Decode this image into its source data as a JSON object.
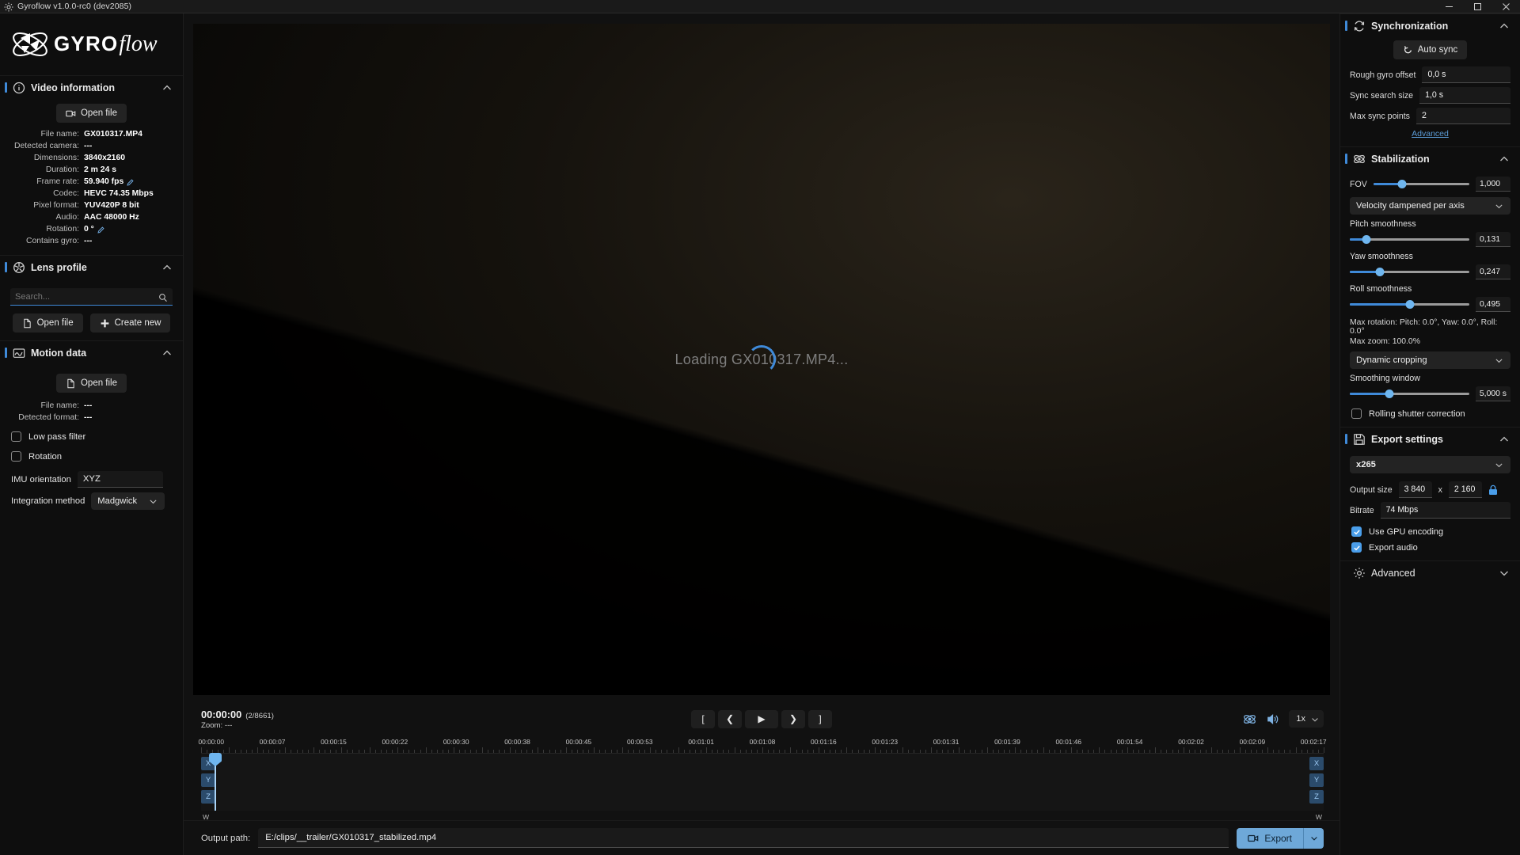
{
  "window": {
    "title": "Gyroflow v1.0.0-rc0 (dev2085)",
    "minimize": "─",
    "maximize": "☐",
    "close": "✕"
  },
  "brand": {
    "gyro": "GYRO",
    "flow": "flow"
  },
  "sidebar": {
    "video_information": {
      "title": "Video information",
      "open_file": "Open file",
      "fields": [
        {
          "label": "File name:",
          "value": "GX010317.MP4",
          "edit": false
        },
        {
          "label": "Detected camera:",
          "value": "---",
          "edit": false
        },
        {
          "label": "Dimensions:",
          "value": "3840x2160",
          "edit": false
        },
        {
          "label": "Duration:",
          "value": "2 m 24 s",
          "edit": false
        },
        {
          "label": "Frame rate:",
          "value": "59.940 fps",
          "edit": true
        },
        {
          "label": "Codec:",
          "value": "HEVC 74.35 Mbps",
          "edit": false
        },
        {
          "label": "Pixel format:",
          "value": "YUV420P 8 bit",
          "edit": false
        },
        {
          "label": "Audio:",
          "value": "AAC 48000 Hz",
          "edit": false
        },
        {
          "label": "Rotation:",
          "value": "0 °",
          "edit": true
        },
        {
          "label": "Contains gyro:",
          "value": "---",
          "edit": false
        }
      ]
    },
    "lens_profile": {
      "title": "Lens profile",
      "search_placeholder": "Search...",
      "search_value": "",
      "open_file": "Open file",
      "create_new": "Create new"
    },
    "motion_data": {
      "title": "Motion data",
      "open_file": "Open file",
      "fields": [
        {
          "label": "File name:",
          "value": "---"
        },
        {
          "label": "Detected format:",
          "value": "---"
        }
      ],
      "low_pass_filter": {
        "label": "Low pass filter",
        "checked": false
      },
      "rotation": {
        "label": "Rotation",
        "checked": false
      },
      "imu_orientation": {
        "label": "IMU orientation",
        "value": "XYZ"
      },
      "integration_method": {
        "label": "Integration method",
        "value": "Madgwick"
      }
    }
  },
  "video": {
    "loading_text": "Loading GX010317.MP4..."
  },
  "player": {
    "timecode": "00:00:00",
    "frames": "(2/8661)",
    "zoom_label": "Zoom:",
    "zoom_value": "---",
    "transport": [
      {
        "name": "trim-start-button",
        "glyph": "["
      },
      {
        "name": "previous-frame-button",
        "glyph": "❮"
      },
      {
        "name": "play-button",
        "glyph": "▶"
      },
      {
        "name": "next-frame-button",
        "glyph": "❯"
      },
      {
        "name": "trim-end-button",
        "glyph": "]"
      }
    ],
    "speed": "1x"
  },
  "timeline": {
    "ticks": [
      "00:00:00",
      "00:00:07",
      "00:00:15",
      "00:00:22",
      "00:00:30",
      "00:00:38",
      "00:00:45",
      "00:00:53",
      "00:01:01",
      "00:01:08",
      "00:01:16",
      "00:01:23",
      "00:01:31",
      "00:01:39",
      "00:01:46",
      "00:01:54",
      "00:02:02",
      "00:02:09",
      "00:02:17"
    ],
    "axes": [
      "X",
      "Y",
      "Z"
    ],
    "w_label_left": "W",
    "w_label_right": "W",
    "playhead_percent": 1.2
  },
  "output": {
    "label": "Output path:",
    "value": "E:/clips/__trailer/GX010317_stabilized.mp4",
    "export_label": "Export"
  },
  "right": {
    "synchronization": {
      "title": "Synchronization",
      "auto_sync": "Auto sync",
      "fields": [
        {
          "label": "Rough gyro offset",
          "value": "0,0 s"
        },
        {
          "label": "Sync search size",
          "value": "1,0 s"
        },
        {
          "label": "Max sync points",
          "value": "2"
        }
      ],
      "advanced_link": "Advanced"
    },
    "stabilization": {
      "title": "Stabilization",
      "fov": {
        "label": "FOV",
        "value": "1,000",
        "percent": 30
      },
      "method": "Velocity dampened per axis",
      "smoothness": [
        {
          "label": "Pitch smoothness",
          "value": "0,131",
          "percent": 14
        },
        {
          "label": "Yaw smoothness",
          "value": "0,247",
          "percent": 25
        },
        {
          "label": "Roll smoothness",
          "value": "0,495",
          "percent": 50
        }
      ],
      "max_rotation": "Max rotation: Pitch: 0.0°, Yaw: 0.0°, Roll: 0.0°",
      "max_zoom": "Max zoom: 100.0%",
      "cropping": "Dynamic cropping",
      "smoothing_window": {
        "label": "Smoothing window",
        "value": "5,000 s",
        "percent": 33
      },
      "rolling_shutter": {
        "label": "Rolling shutter correction",
        "checked": false
      }
    },
    "export_settings": {
      "title": "Export settings",
      "codec": "x265",
      "output_size_label": "Output size",
      "width": "3 840",
      "times": "x",
      "height": "2 160",
      "bitrate_label": "Bitrate",
      "bitrate": "74 Mbps",
      "use_gpu": {
        "label": "Use GPU encoding",
        "checked": true
      },
      "export_audio": {
        "label": "Export audio",
        "checked": true
      }
    },
    "advanced": {
      "title": "Advanced"
    }
  },
  "colors": {
    "accent": "#3f8ad9",
    "accent_light": "#6fb6ef",
    "export_button": "#6ea8d8",
    "panel_bg": "#0e0e0e",
    "app_bg": "#111111"
  }
}
